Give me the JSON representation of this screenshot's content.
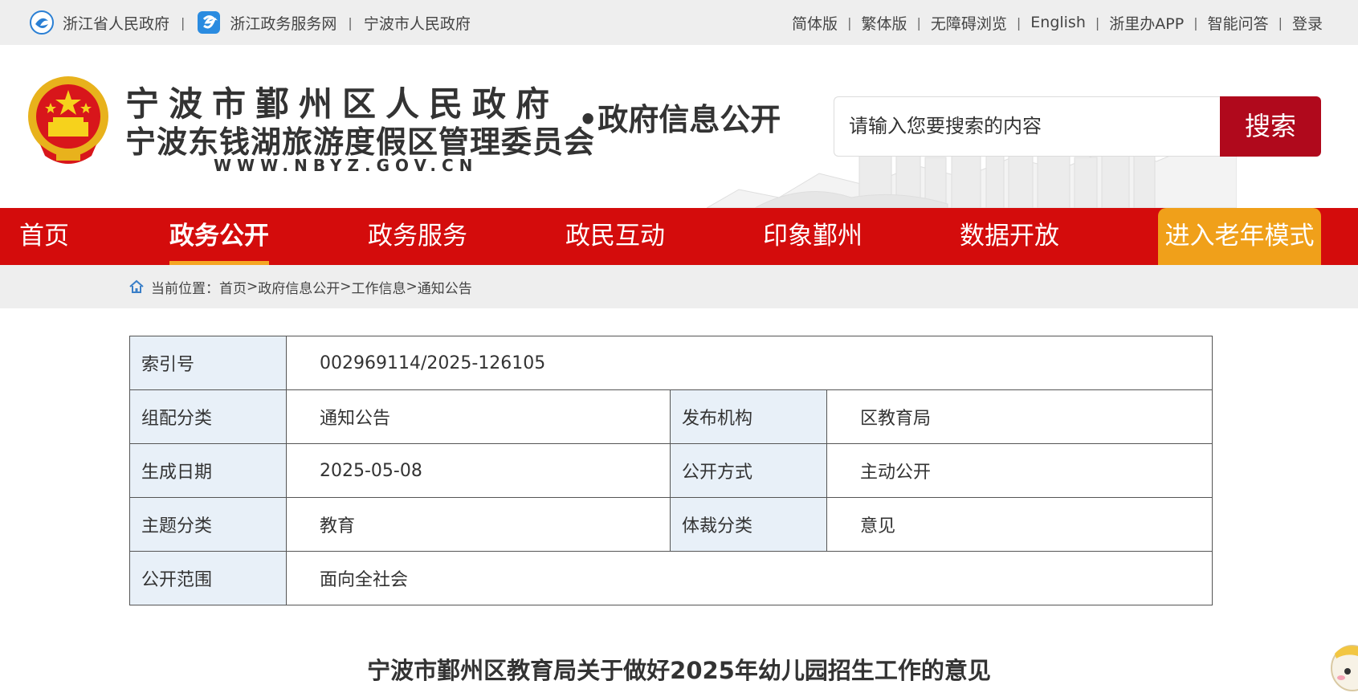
{
  "topbar": {
    "left_links": [
      {
        "label": "浙江省人民政府",
        "icon": "zhejiang-gov-logo-icon"
      },
      {
        "label": "浙江政务服务网",
        "icon": "zwfw-logo-icon"
      },
      {
        "label": "宁波市人民政府"
      }
    ],
    "right_links": [
      "简体版",
      "繁体版",
      "无障碍浏览",
      "English",
      "浙里办APP",
      "智能问答",
      "登录"
    ],
    "separator": "|"
  },
  "header": {
    "org_name": "宁波市鄞州区人民政府",
    "org_name_2": "宁波东钱湖旅游度假区管理委员会",
    "site_url": "WWW.NBYZ.GOV.CN",
    "section": "•政府信息公开",
    "search_placeholder": "请输入您要搜索的内容",
    "search_button": "搜索"
  },
  "nav": {
    "items": [
      "首页",
      "政务公开",
      "政务服务",
      "政民互动",
      "印象鄞州",
      "数据开放"
    ],
    "active": "政务公开",
    "elder_mode": "进入老年模式"
  },
  "breadcrumb": {
    "prefix": "当前位置：",
    "path": [
      "首页",
      "政府信息公开",
      "工作信息",
      "通知公告"
    ],
    "separator": ">"
  },
  "info_table": {
    "index_label": "索引号",
    "index_value": "002969114/2025-126105",
    "category_label": "组配分类",
    "category_value": "通知公告",
    "publisher_label": "发布机构",
    "publisher_value": "区教育局",
    "date_label": "生成日期",
    "date_value": "2025-05-08",
    "disclosure_label": "公开方式",
    "disclosure_value": "主动公开",
    "topic_label": "主题分类",
    "topic_value": "教育",
    "genre_label": "体裁分类",
    "genre_value": "意见",
    "scope_label": "公开范围",
    "scope_value": "面向全社会"
  },
  "article": {
    "title": "宁波市鄞州区教育局关于做好2025年幼儿园招生工作的意见"
  },
  "colors": {
    "nav_red": "#d40c0c",
    "search_button": "#b0091c",
    "elder_orange": "#f0a01a",
    "table_key_bg": "#e8f0f8",
    "active_underline": "#f5a623"
  }
}
